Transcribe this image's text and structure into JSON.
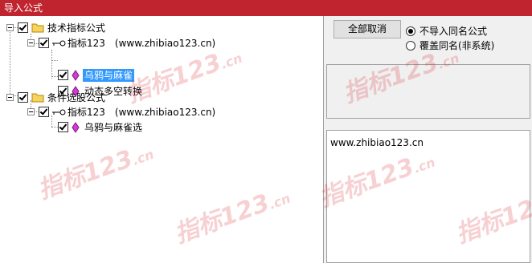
{
  "window": {
    "title": "导入公式",
    "titlebar_color": "#c0242f"
  },
  "tree": {
    "root1": {
      "label": "技术指标公式",
      "checked": true,
      "icon": "folder-icon"
    },
    "root1_child": {
      "label": "指标123　(www.zhibiao123.cn)",
      "checked": true,
      "icon": "key-icon"
    },
    "leaf1": {
      "label": "乌鸦与麻雀",
      "checked": true,
      "selected": true,
      "icon": "diamond-icon"
    },
    "leaf2": {
      "label": "动态多空转换",
      "checked": true,
      "icon": "diamond-icon"
    },
    "root2": {
      "label": "条件选股公式",
      "checked": true,
      "icon": "folder-icon"
    },
    "root2_child": {
      "label": "指标123　(www.zhibiao123.cn)",
      "checked": true,
      "icon": "key-icon"
    },
    "leaf3": {
      "label": "乌鸦与麻雀选",
      "checked": true,
      "icon": "diamond-icon"
    }
  },
  "actions": {
    "cancel_all_label": "全部取消"
  },
  "options": [
    {
      "label": "不导入同名公式",
      "selected": true
    },
    {
      "label": "覆盖同名(非系统)",
      "selected": false
    }
  ],
  "info_text": "www.zhibiao123.cn",
  "watermark": {
    "text": "指标123",
    "suffix": ".cn",
    "color": "#dc2832"
  }
}
